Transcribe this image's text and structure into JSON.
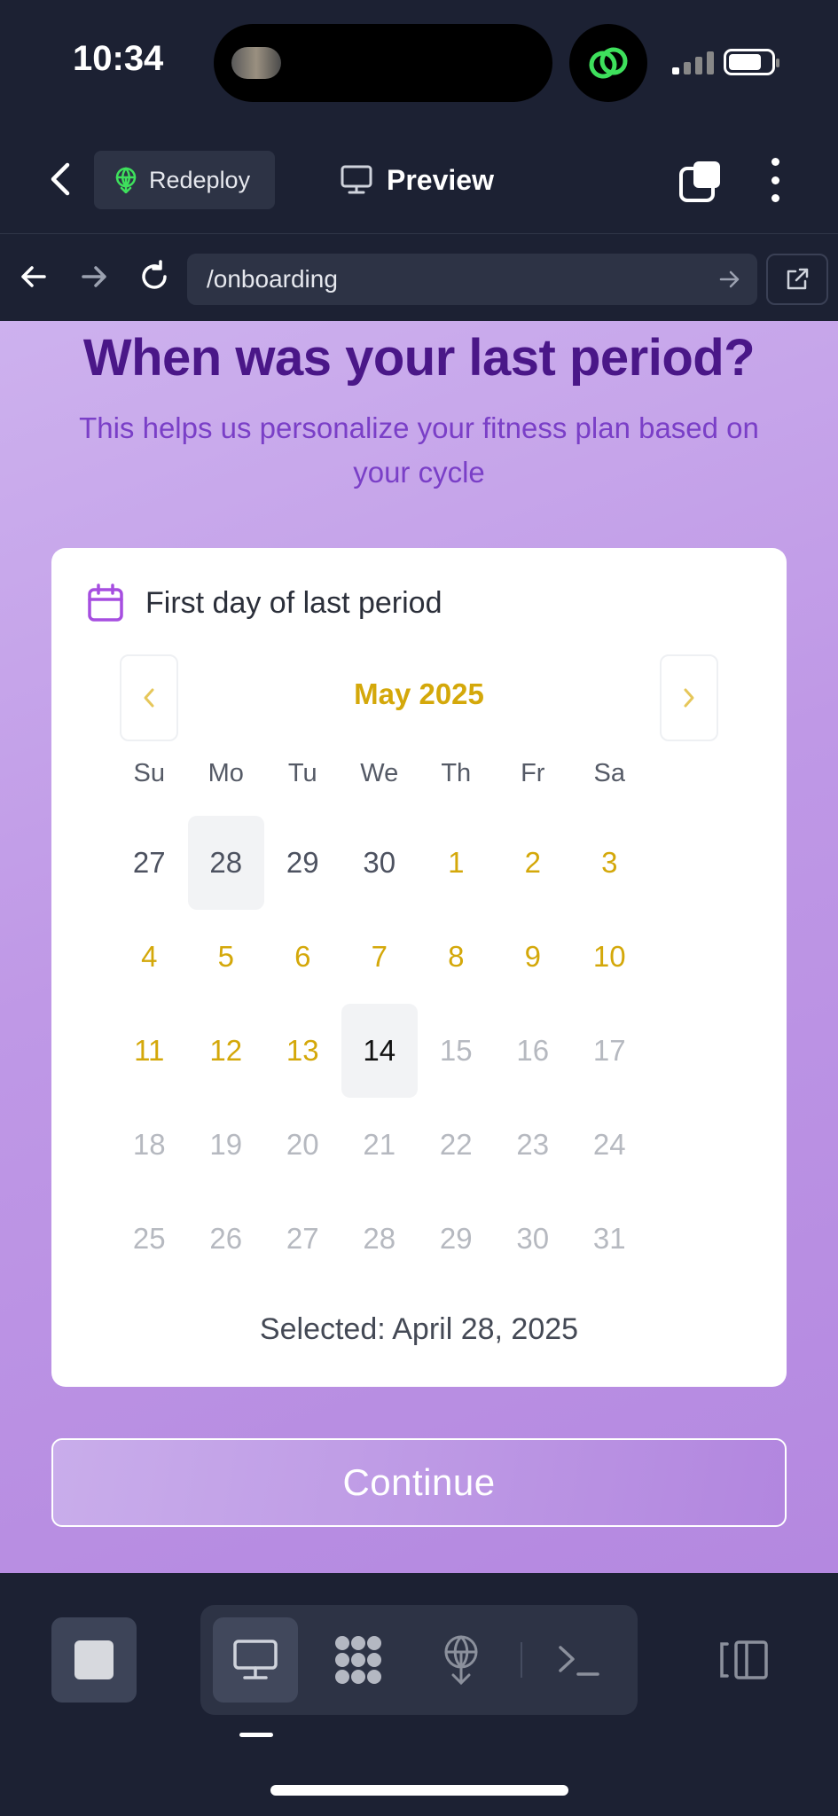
{
  "status_bar": {
    "time": "10:34"
  },
  "toolbar": {
    "redeploy_label": "Redeploy",
    "preview_label": "Preview"
  },
  "browser": {
    "url": "/onboarding"
  },
  "question": {
    "title": "When was your last period?",
    "subtitle": "This helps us personalize your fitness plan based on your cycle"
  },
  "calendar": {
    "card_title": "First day of last period",
    "month_label": "May 2025",
    "weekdays": [
      "Su",
      "Mo",
      "Tu",
      "We",
      "Th",
      "Fr",
      "Sa"
    ],
    "weeks": [
      [
        "27",
        "28",
        "29",
        "30",
        "1",
        "2",
        "3"
      ],
      [
        "4",
        "5",
        "6",
        "7",
        "8",
        "9",
        "10"
      ],
      [
        "11",
        "12",
        "13",
        "14",
        "15",
        "16",
        "17"
      ],
      [
        "18",
        "19",
        "20",
        "21",
        "22",
        "23",
        "24"
      ],
      [
        "25",
        "26",
        "27",
        "28",
        "29",
        "30",
        "31"
      ]
    ],
    "selected_text": "Selected: April 28, 2025"
  },
  "continue_label": "Continue",
  "colors": {
    "accent_yellow": "#d4a80a",
    "title_purple": "#4a1788",
    "subtitle_purple": "#7a3fc7",
    "background_dark": "#1c2133"
  }
}
